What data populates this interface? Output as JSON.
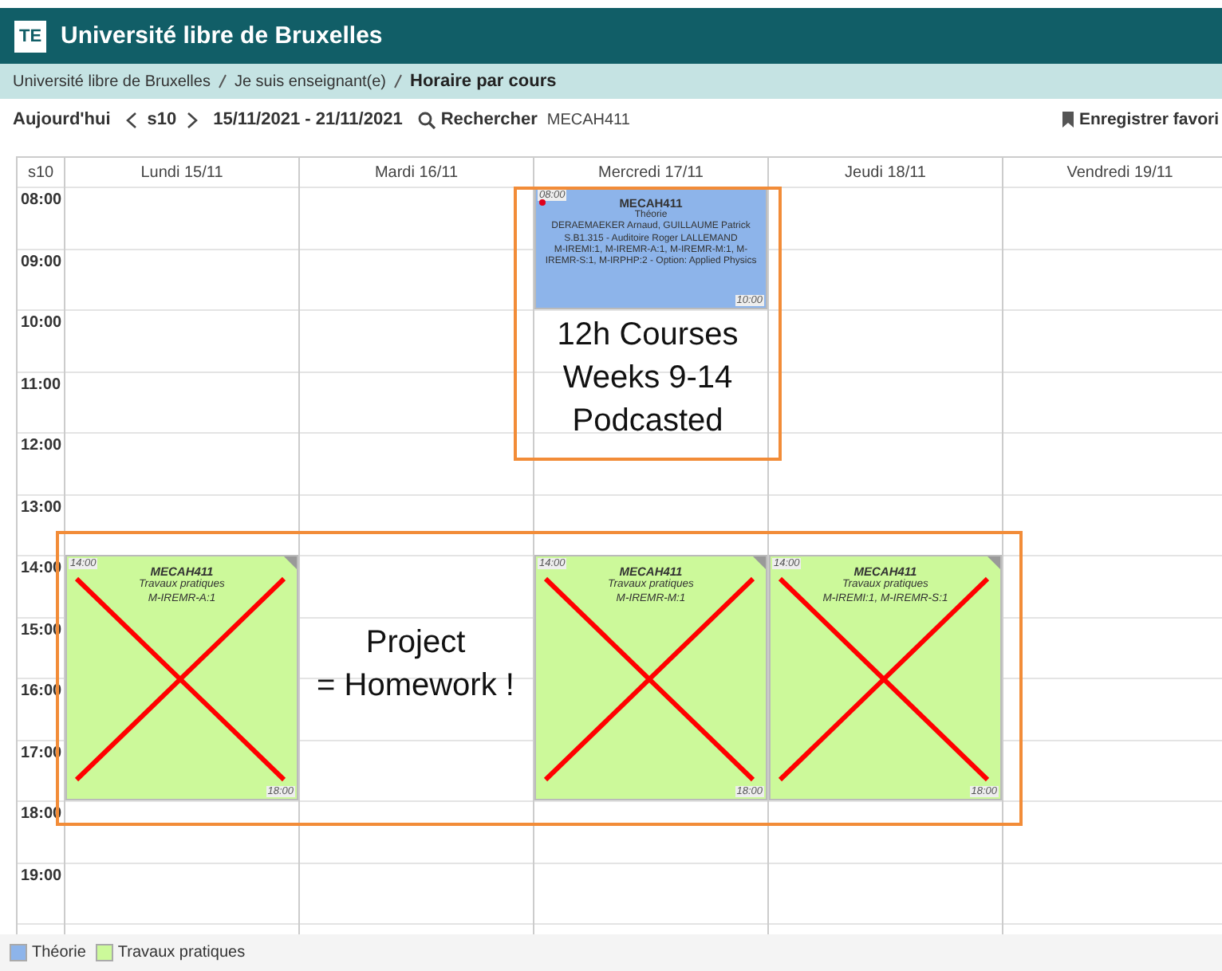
{
  "header": {
    "logo": "TE",
    "title": "Université libre de Bruxelles"
  },
  "breadcrumb": [
    {
      "label": "Université libre de Bruxelles",
      "current": false
    },
    {
      "label": "Je suis enseignant(e)",
      "current": false
    },
    {
      "label": "Horaire par cours",
      "current": true
    }
  ],
  "toolbar": {
    "today": "Aujourd'hui",
    "week": "s10",
    "date_range": "15/11/2021 - 21/11/2021",
    "search_label": "Rechercher",
    "search_value": "MECAH411",
    "save": "Enregistrer favori"
  },
  "calendar": {
    "week_label": "s10",
    "days": [
      "Lundi 15/11",
      "Mardi 16/11",
      "Mercredi 17/11",
      "Jeudi 18/11",
      "Vendredi 19/11"
    ],
    "hours": [
      "08:00",
      "09:00",
      "10:00",
      "11:00",
      "12:00",
      "13:00",
      "14:00",
      "15:00",
      "16:00",
      "17:00",
      "18:00",
      "19:00"
    ],
    "events": [
      {
        "kind": "theorie",
        "start_label": "08:00",
        "end_label": "10:00",
        "title": "MECAH411",
        "lines": [
          "Théorie",
          "DERAEMAEKER Arnaud, GUILLAUME Patrick",
          "S.B1.315 - Auditoire Roger LALLEMAND",
          "M-IREMI:1, M-IREMR-A:1, M-IREMR-M:1, M-IREMR-S:1, M-IRPHP:2 - Option: Applied Physics"
        ],
        "flagged": true,
        "crossed_out": false
      },
      {
        "kind": "tp",
        "start_label": "14:00",
        "end_label": "18:00",
        "title": "MECAH411",
        "lines": [
          "Travaux pratiques",
          "M-IREMR-A:1"
        ],
        "flagged": false,
        "crossed_out": true
      },
      {
        "kind": "tp",
        "start_label": "14:00",
        "end_label": "18:00",
        "title": "MECAH411",
        "lines": [
          "Travaux pratiques",
          "M-IREMR-M:1"
        ],
        "flagged": false,
        "crossed_out": true
      },
      {
        "kind": "tp",
        "start_label": "14:00",
        "end_label": "18:00",
        "title": "MECAH411",
        "lines": [
          "Travaux pratiques",
          "M-IREMI:1, M-IREMR-S:1"
        ],
        "flagged": false,
        "crossed_out": true
      }
    ]
  },
  "annotations": [
    {
      "kind": "box",
      "lines": [
        "12h Courses",
        "Weeks 9-14",
        "Podcasted"
      ]
    },
    {
      "kind": "box",
      "lines": [
        "Project",
        "= Homework !"
      ]
    }
  ],
  "legend": [
    {
      "label": "Théorie",
      "color": "#8db4ea"
    },
    {
      "label": "Travaux pratiques",
      "color": "#ccf99a"
    }
  ]
}
